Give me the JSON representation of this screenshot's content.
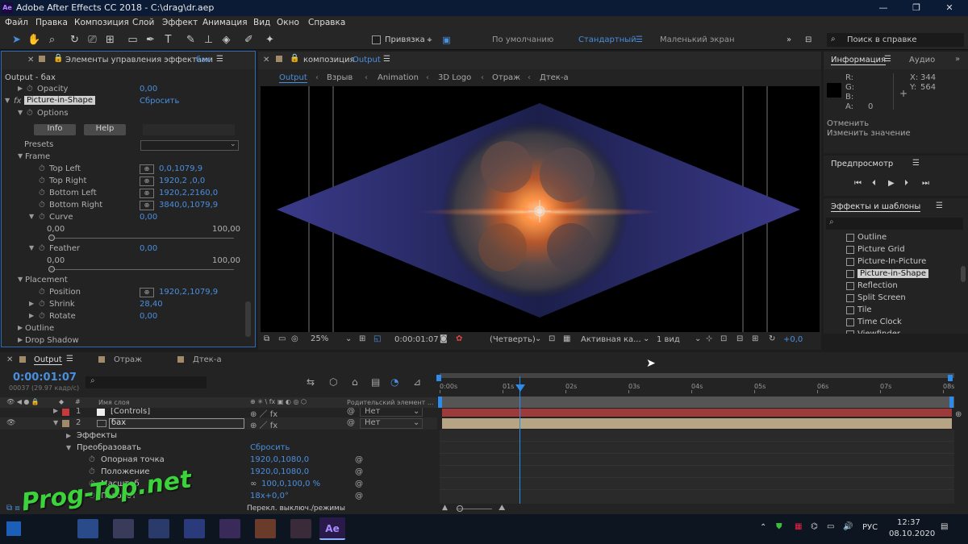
{
  "titlebar": {
    "app_title": "Adobe After Effects CC 2018 - C:\\drag\\dr.aep",
    "app_icon": "Ae"
  },
  "menu": [
    "Файл",
    "Правка",
    "Композиция",
    "Слой",
    "Эффект",
    "Анимация",
    "Вид",
    "Окно",
    "Справка"
  ],
  "toolbar": {
    "snap_label": "Привязка",
    "workspaces": [
      "По умолчанию",
      "Стандартный",
      "Маленький экран"
    ],
    "active_workspace": "Стандартный",
    "search_placeholder": "Поиск в справке"
  },
  "effect_panel": {
    "tab_title": "Элементы управления эффектами",
    "tab_layer": "бах",
    "breadcrumb": "Output - бах",
    "opacity": {
      "label": "Opacity",
      "value": "0,00"
    },
    "effect_name": "Picture-in-Shape",
    "reset": "Сбросить",
    "fx": "fx",
    "options": "Options",
    "info_btn": "Info",
    "help_btn": "Help",
    "presets": "Presets",
    "frame": "Frame",
    "top_left": {
      "label": "Top Left",
      "value": "0,0,1079,9"
    },
    "top_right": {
      "label": "Top Right",
      "value": "1920,2 ,0,0"
    },
    "bottom_left": {
      "label": "Bottom Left",
      "value": "1920,2,2160,0"
    },
    "bottom_right": {
      "label": "Bottom Right",
      "value": "3840,0,1079,9"
    },
    "curve": {
      "label": "Curve",
      "value": "0,00",
      "min": "0,00",
      "max": "100,00"
    },
    "feather": {
      "label": "Feather",
      "value": "0,00",
      "min": "0,00",
      "max": "100,00"
    },
    "placement": "Placement",
    "position": {
      "label": "Position",
      "value": "1920,2,1079,9"
    },
    "shrink": {
      "label": "Shrink",
      "value": "28,40"
    },
    "rotate": {
      "label": "Rotate",
      "value": "0,00"
    },
    "outline": "Outline",
    "drop_shadow": "Drop Shadow"
  },
  "composition": {
    "tab_prefix": "композиция",
    "tab_name": "Output",
    "crumbs": [
      "Output",
      "Взрыв",
      "Animation",
      "3D Logo",
      "Отраж",
      "Дтек-а"
    ],
    "zoom": "25%",
    "timecode": "0:00:01:07",
    "resolution": "(Четверть)",
    "camera": "Активная ка...",
    "views": "1 вид",
    "offset": "+0,0"
  },
  "info_panel": {
    "tab": "Информация",
    "tab2": "Аудио",
    "r": "R:",
    "g": "G:",
    "b": "B:",
    "a": "A:",
    "a_val": "0",
    "x": "X:",
    "x_val": "344",
    "y": "Y:",
    "y_val": "564",
    "undo": "Отменить",
    "change": "Изменить значение"
  },
  "preview_panel": {
    "title": "Предпросмотр"
  },
  "effects_panel": {
    "title": "Эффекты и шаблоны",
    "items": [
      "Outline",
      "Picture Grid",
      "Picture-In-Picture",
      "Picture-in-Shape",
      "Reflection",
      "Split Screen",
      "Tile",
      "Time Clock",
      "Viewfinder"
    ],
    "selected": "Picture-in-Shape"
  },
  "timeline": {
    "tabs": [
      "Output",
      "Отраж",
      "Дтек-а"
    ],
    "active_tab": "Output",
    "timecode": "0:00:01:07",
    "frames": "00037 (29.97 кадр/с)",
    "col_name": "Имя слоя",
    "col_parent": "Родительский элемент ...",
    "ruler": [
      "0:00s",
      "01s",
      "02s",
      "03s",
      "04s",
      "05s",
      "06s",
      "07s",
      "08s"
    ],
    "layers": [
      {
        "num": "1",
        "name": "[Controls]",
        "parent": "Нет",
        "color": "#c83a3a"
      },
      {
        "num": "2",
        "name": "бах",
        "parent": "Нет",
        "color": "#a08a6a"
      }
    ],
    "props": {
      "effects": "Эффекты",
      "transform": "Преобразовать",
      "reset": "Сбросить",
      "anchor": {
        "label": "Опорная точка",
        "value": "1920,0,1080,0"
      },
      "position": {
        "label": "Положение",
        "value": "1920,0,1080,0"
      },
      "scale": {
        "label": "Масштаб",
        "value": "100,0,100,0 %"
      },
      "rotation": {
        "label": "Поворот",
        "value": "18x+0,0°"
      }
    },
    "mode_toggle": "Перекл. выключ./режимы"
  },
  "watermark": "Prog-Top.net",
  "taskbar": {
    "lang": "РУС",
    "time": "12:37",
    "date": "08.10.2020",
    "active_app": "Ae"
  },
  "colors": {
    "accent": "#2d8ceb",
    "value_blue": "#4a8fde",
    "watermark": "#3bd23b"
  }
}
